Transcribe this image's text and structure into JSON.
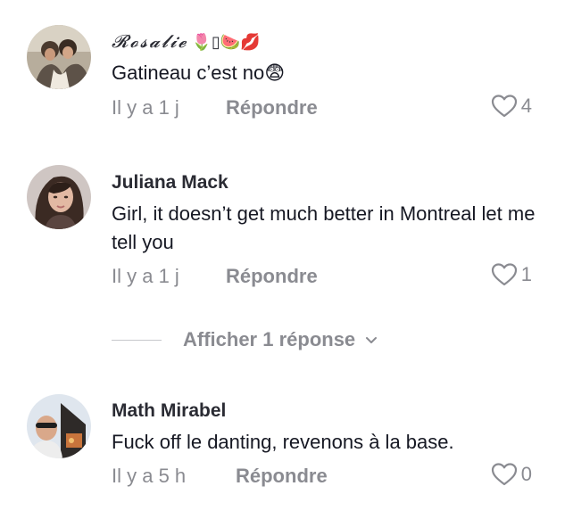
{
  "comments": [
    {
      "username": "𝓡𝓸𝓼𝓪𝓵𝓲𝓮",
      "username_emoji": "🌷▯🍉💋",
      "text": "Gatineau c’est no😨",
      "time": "Il y a 1 j",
      "reply_label": "Répondre",
      "likes": "4"
    },
    {
      "username": "Juliana Mack",
      "text": "Girl, it doesn’t get much better in Montreal let me tell you",
      "time": "Il y a 1 j",
      "reply_label": "Répondre",
      "likes": "1"
    },
    {
      "username": "Math Mirabel",
      "text": "Fuck off le danting, revenons à la base.",
      "time": "Il y a 5 h",
      "reply_label": "Répondre",
      "likes": "0"
    }
  ],
  "view_replies": {
    "label": "Afficher 1 réponse"
  },
  "colors": {
    "muted": "#8a8b91",
    "text": "#161823",
    "divider": "#c7c8cc"
  },
  "icons": {
    "like": "heart-outline-icon",
    "expand": "chevron-down-icon"
  }
}
